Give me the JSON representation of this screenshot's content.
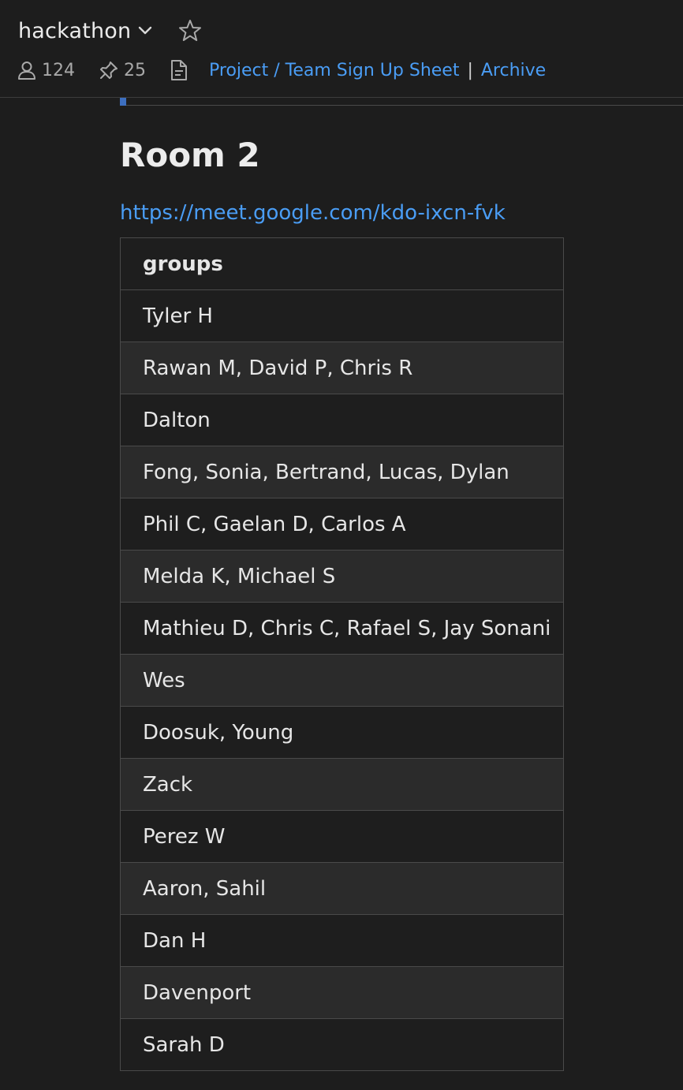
{
  "header": {
    "channel_name": "hackathon",
    "member_count": "124",
    "pinned_count": "25",
    "links": [
      {
        "label": "Project / Team Sign Up Sheet"
      },
      {
        "label": "Archive"
      }
    ],
    "separator": "|"
  },
  "content": {
    "heading": "Room 2",
    "meet_link": "https://meet.google.com/kdo-ixcn-fvk",
    "table": {
      "header": "groups",
      "rows": [
        "Tyler H",
        "Rawan M, David P, Chris R",
        "Dalton",
        "Fong, Sonia, Bertrand, Lucas, Dylan",
        "Phil C, Gaelan D, Carlos A",
        "Melda K, Michael S",
        "Mathieu D, Chris C, Rafael S, Jay Sonani",
        "Wes",
        "Doosuk, Young",
        "Zack",
        "Perez W",
        "Aaron, Sahil",
        "Dan H",
        "Davenport",
        "Sarah D"
      ]
    }
  },
  "colors": {
    "background": "#1d1d1d",
    "link": "#4a9df5",
    "accent": "#3d6fbf"
  },
  "icons": {
    "chevron": "chevron-down-icon",
    "star": "star-icon",
    "members": "person-icon",
    "pins": "pin-icon",
    "canvas": "document-icon"
  }
}
